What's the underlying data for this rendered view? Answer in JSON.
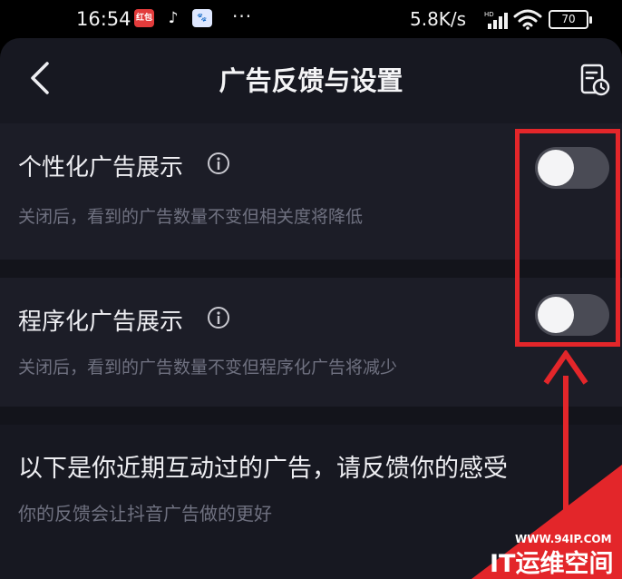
{
  "status_bar": {
    "time": "16:54",
    "net_speed": "5.8K/s",
    "network_tag": "HD",
    "battery": "70",
    "more_dots": "···",
    "app_icon_1_text": "红包",
    "app_icon_2_text": "♪",
    "app_icon_3_text": "🐾"
  },
  "header": {
    "title": "广告反馈与设置"
  },
  "settings": [
    {
      "title": "个性化广告展示",
      "description": "关闭后，看到的广告数量不变但相关度将降低",
      "enabled": false
    },
    {
      "title": "程序化广告展示",
      "description": "关闭后，看到的广告数量不变但程序化广告将减少",
      "enabled": false
    }
  ],
  "feedback": {
    "title": "以下是你近期互动过的广告，请反馈你的感受",
    "description": "你的反馈会让抖音广告做的更好"
  },
  "watermark": {
    "url": "WWW.94IP.COM",
    "name": "IT运维空间"
  },
  "colors": {
    "background": "#171821",
    "annotation_red": "#e3262a",
    "toggle_off": "#4a4b55"
  }
}
